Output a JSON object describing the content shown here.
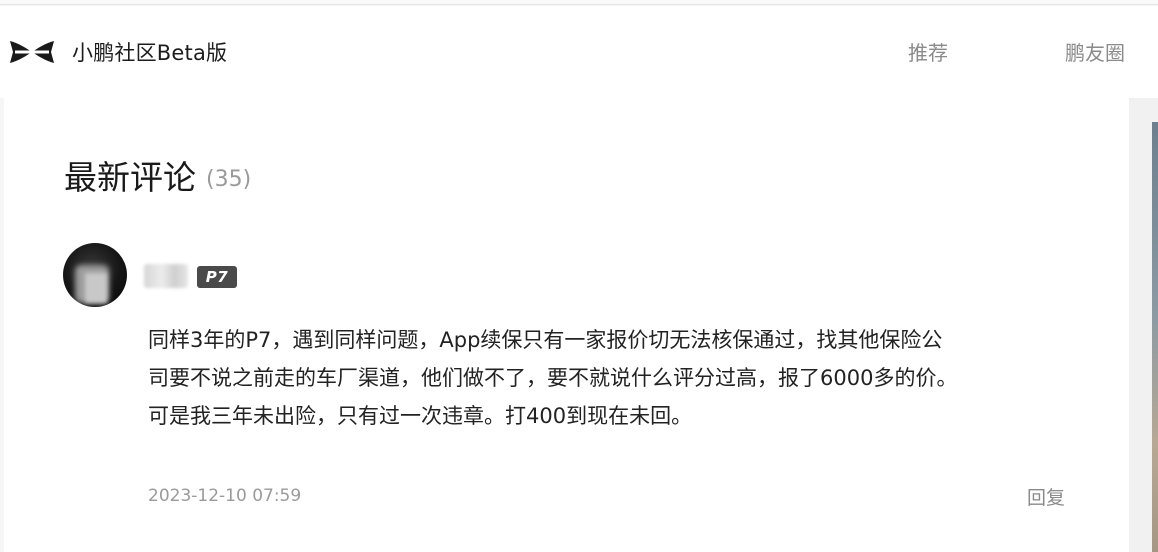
{
  "header": {
    "brand": "小鹏社区Beta版",
    "logo_icon": "xpeng-x-logo-icon",
    "nav": [
      {
        "label": "推荐"
      },
      {
        "label": "鹏友圈"
      }
    ]
  },
  "comments_section": {
    "title": "最新评论",
    "count": "(35)"
  },
  "comment": {
    "avatar_icon": "user-avatar",
    "badge": "P7",
    "body_lines": [
      "同样3年的P7，遇到同样问题，App续保只有一家报价切无法核保通过，找其他保险公",
      "司要不说之前走的车厂渠道，他们做不了，要不就说什么评分过高，报了6000多的价。",
      "可是我三年未出险，只有过一次违章。打400到现在未回。"
    ],
    "timestamp": "2023-12-10 07:59",
    "reply_label": "回复"
  },
  "colors": {
    "background": "#f6f6f6",
    "card": "#ffffff",
    "badge": "#4a4a4a",
    "muted_text": "#9a9a9a"
  }
}
